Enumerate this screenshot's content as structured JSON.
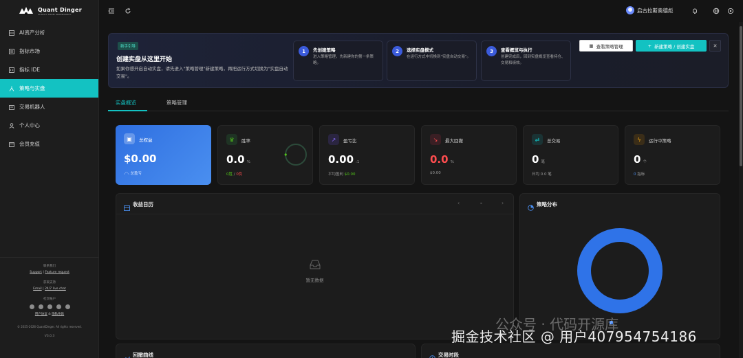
{
  "app": {
    "name": "Quant Dinger",
    "tagline": "CLARITY FROM UNCERTAINTY"
  },
  "sidebar": {
    "items": [
      {
        "label": "AI资产分析",
        "icon": "grid-icon"
      },
      {
        "label": "指标市场",
        "icon": "store-icon"
      },
      {
        "label": "指标 IDE",
        "icon": "code-icon"
      },
      {
        "label": "策略与实盘",
        "icon": "strategy-icon",
        "active": true
      },
      {
        "label": "交易机器人",
        "icon": "robot-icon"
      },
      {
        "label": "个人中心",
        "icon": "user-icon"
      },
      {
        "label": "会员充值",
        "icon": "wallet-icon"
      }
    ],
    "footer": {
      "contact_label": "联系我们",
      "support": "Support",
      "feature": "Feature request",
      "get_support_label": "获取支持",
      "email": "Email",
      "live_chat": "24/7 live chat",
      "social_label": "社交账户",
      "terms": "用户协议",
      "and": "&",
      "privacy": "隐私条款",
      "copyright": "© 2025-2026 QuantDinger. All rights reserved.",
      "version": "V3.0.3"
    }
  },
  "header": {
    "username": "启古拉斯奥德彪"
  },
  "guide": {
    "badge": "新手引导",
    "title": "创建实盘从这里开始",
    "desc": "如果你想开启自动实盘，请先进入\"策略管理\"新建策略，再把运行方式切换为\"实盘自动交易\"。",
    "steps": [
      {
        "num": "1",
        "title": "先创建策略",
        "desc": "进入策略管理，先新建你的第一条策略。"
      },
      {
        "num": "2",
        "title": "选择实盘模式",
        "desc": "在运行方式中切换到\"实盘自动交易\"。"
      },
      {
        "num": "3",
        "title": "查看概览与执行",
        "desc": "创建完成后，回到实盘概览查看持仓、交易和绩效。"
      }
    ],
    "view_btn": "查看策略管理",
    "create_btn": "新建策略 / 创建实盘",
    "close_btn": "✕"
  },
  "tabs": [
    {
      "label": "实盘概览",
      "active": true
    },
    {
      "label": "策略管理",
      "active": false
    }
  ],
  "stats": [
    {
      "title": "总权益",
      "value": "$0.00",
      "sub": "总盈亏",
      "icon": "wallet-icon"
    },
    {
      "title": "胜率",
      "value": "0.0",
      "unit": "%",
      "sub_win": "0胜",
      "sub_sep": "/",
      "sub_loss": "0负",
      "icon": "trophy-icon"
    },
    {
      "title": "盈亏比",
      "value": "0.00",
      "unit": ":1",
      "sub": "平均盈利",
      "sub_value": "$0.00",
      "icon": "trend-icon"
    },
    {
      "title": "最大回撤",
      "value": "0.0",
      "unit": "%",
      "sub": "$0.00",
      "icon": "drawdown-icon"
    },
    {
      "title": "总交易",
      "value": "0",
      "unit": "笔",
      "sub": "日均 0.0 笔",
      "icon": "swap-icon"
    },
    {
      "title": "运行中策略",
      "value": "0",
      "unit": "个",
      "sub_num": "0",
      "sub": "指标",
      "icon": "bolt-icon"
    }
  ],
  "calendar": {
    "title": "收益日历",
    "center": "-",
    "empty": "暂无数据"
  },
  "distribution": {
    "title": "策略分布"
  },
  "bottom": {
    "left_title": "回撤曲线",
    "right_title": "交易时段"
  },
  "colors": {
    "accent": "#13c2c2",
    "primary_card": "#3b7ef0",
    "danger": "#ff4d4f",
    "profit": "#52c41a"
  },
  "watermark": {
    "line1": "公众号 · 代码开源库",
    "line2": "掘金技术社区 @ 用户407954754186"
  }
}
